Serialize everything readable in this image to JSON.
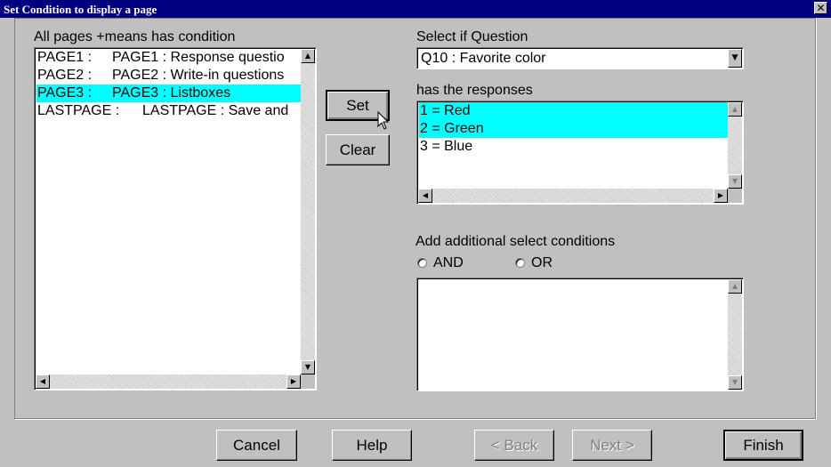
{
  "window": {
    "title": "Set Condition to display a page",
    "close_glyph": "✕"
  },
  "pages_panel": {
    "label": "All pages  +means has condition",
    "items": [
      {
        "id": "PAGE1 :",
        "title": "PAGE1 : Response questio",
        "selected": false
      },
      {
        "id": "PAGE2 :",
        "title": "PAGE2 : Write-in questions",
        "selected": false
      },
      {
        "id": "PAGE3 :",
        "title": "PAGE3 : Listboxes",
        "selected": true
      },
      {
        "id": "LASTPAGE :",
        "title": "LASTPAGE : Save and",
        "selected": false
      }
    ]
  },
  "buttons": {
    "set": "Set",
    "clear": "Clear"
  },
  "question": {
    "label": "Select if Question",
    "selected": "Q10 : Favorite color"
  },
  "responses": {
    "label": "has the responses",
    "items": [
      {
        "text": "1 = Red",
        "selected": true
      },
      {
        "text": "2 = Green",
        "selected": true
      },
      {
        "text": "3 = Blue",
        "selected": false
      }
    ]
  },
  "additional": {
    "label": "Add additional select conditions",
    "and_label": "AND",
    "or_label": "OR"
  },
  "footer": {
    "cancel": "Cancel",
    "help": "Help",
    "back": "< Back",
    "next": "Next >",
    "finish": "Finish"
  },
  "colors": {
    "titlebar": "#000080",
    "selection": "#00ffff",
    "face": "#c0c0c0"
  },
  "icons": {
    "scroll_up": "▲",
    "scroll_down": "▼",
    "scroll_left": "◀",
    "scroll_right": "▶",
    "combo": "▼"
  }
}
